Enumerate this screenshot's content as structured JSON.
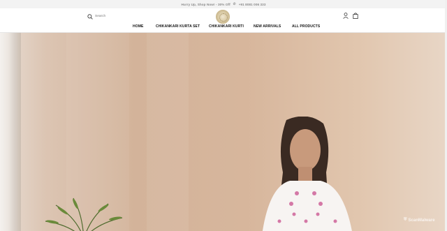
{
  "announcement": {
    "promo": "Hurry Up, Shop Now! - 30% Off",
    "phone": "+91 8081 006 333"
  },
  "header": {
    "search_placeholder": "Search"
  },
  "nav": [
    "HOME",
    "CHIKANKARI KURTA SET",
    "CHIKANKARI KURTI",
    "NEW ARRIVALS",
    "ALL PRODUCTS"
  ],
  "watermark": "ScanMalware",
  "icons": {
    "search": "search-icon",
    "account": "user-icon",
    "cart": "shopping-bag-icon",
    "phone": "phone-icon"
  }
}
